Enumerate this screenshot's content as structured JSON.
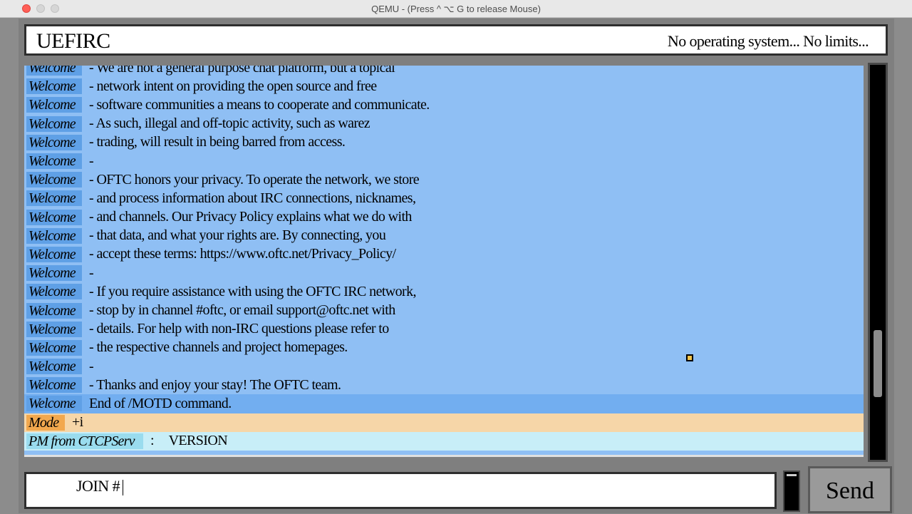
{
  "window": {
    "title": "QEMU - (Press  ^ ⌥ G  to release Mouse)"
  },
  "app": {
    "title": "UEFIRC",
    "slogan": "No operating system... No limits..."
  },
  "chat": {
    "welcome_label": "Welcome",
    "messages": [
      "- We are not a general purpose chat platform, but a topical",
      "- network intent on providing the open source and free",
      "- software communities a means to cooperate and communicate.",
      "- As such, illegal and off-topic activity, such as warez",
      "- trading, will result in being barred from access.",
      "-",
      "- OFTC honors your privacy. To operate the network, we store",
      "- and process information about IRC connections, nicknames,",
      "- and channels. Our Privacy Policy explains what we do with",
      "- that data, and what your rights are. By connecting, you",
      "- accept these terms: https://www.oftc.net/Privacy_Policy/",
      "-",
      "- If you require assistance with using the OFTC IRC network,",
      "- stop by in channel #oftc, or email support@oftc.net with",
      "- details. For help with non-IRC questions please refer to",
      "- the respective channels and project homepages.",
      "-",
      "- Thanks and enjoy your stay! The OFTC team."
    ],
    "end_motd": "End of /MOTD command.",
    "mode_label": "Mode",
    "mode_value": "+i",
    "pm_label": "PM from CTCPServ",
    "pm_separator": ":",
    "pm_message": "VERSION"
  },
  "input": {
    "value": "JOIN #"
  },
  "send_button": {
    "label": "Send"
  },
  "colors": {
    "chat_background": "#8fbff4",
    "welcome_label_bg": "#5fa0e6",
    "mode_row_bg": "#f6d6a8",
    "mode_label_bg": "#f2a84e",
    "pm_row_bg": "#c8eef8",
    "pm_label_bg": "#9adcee"
  }
}
